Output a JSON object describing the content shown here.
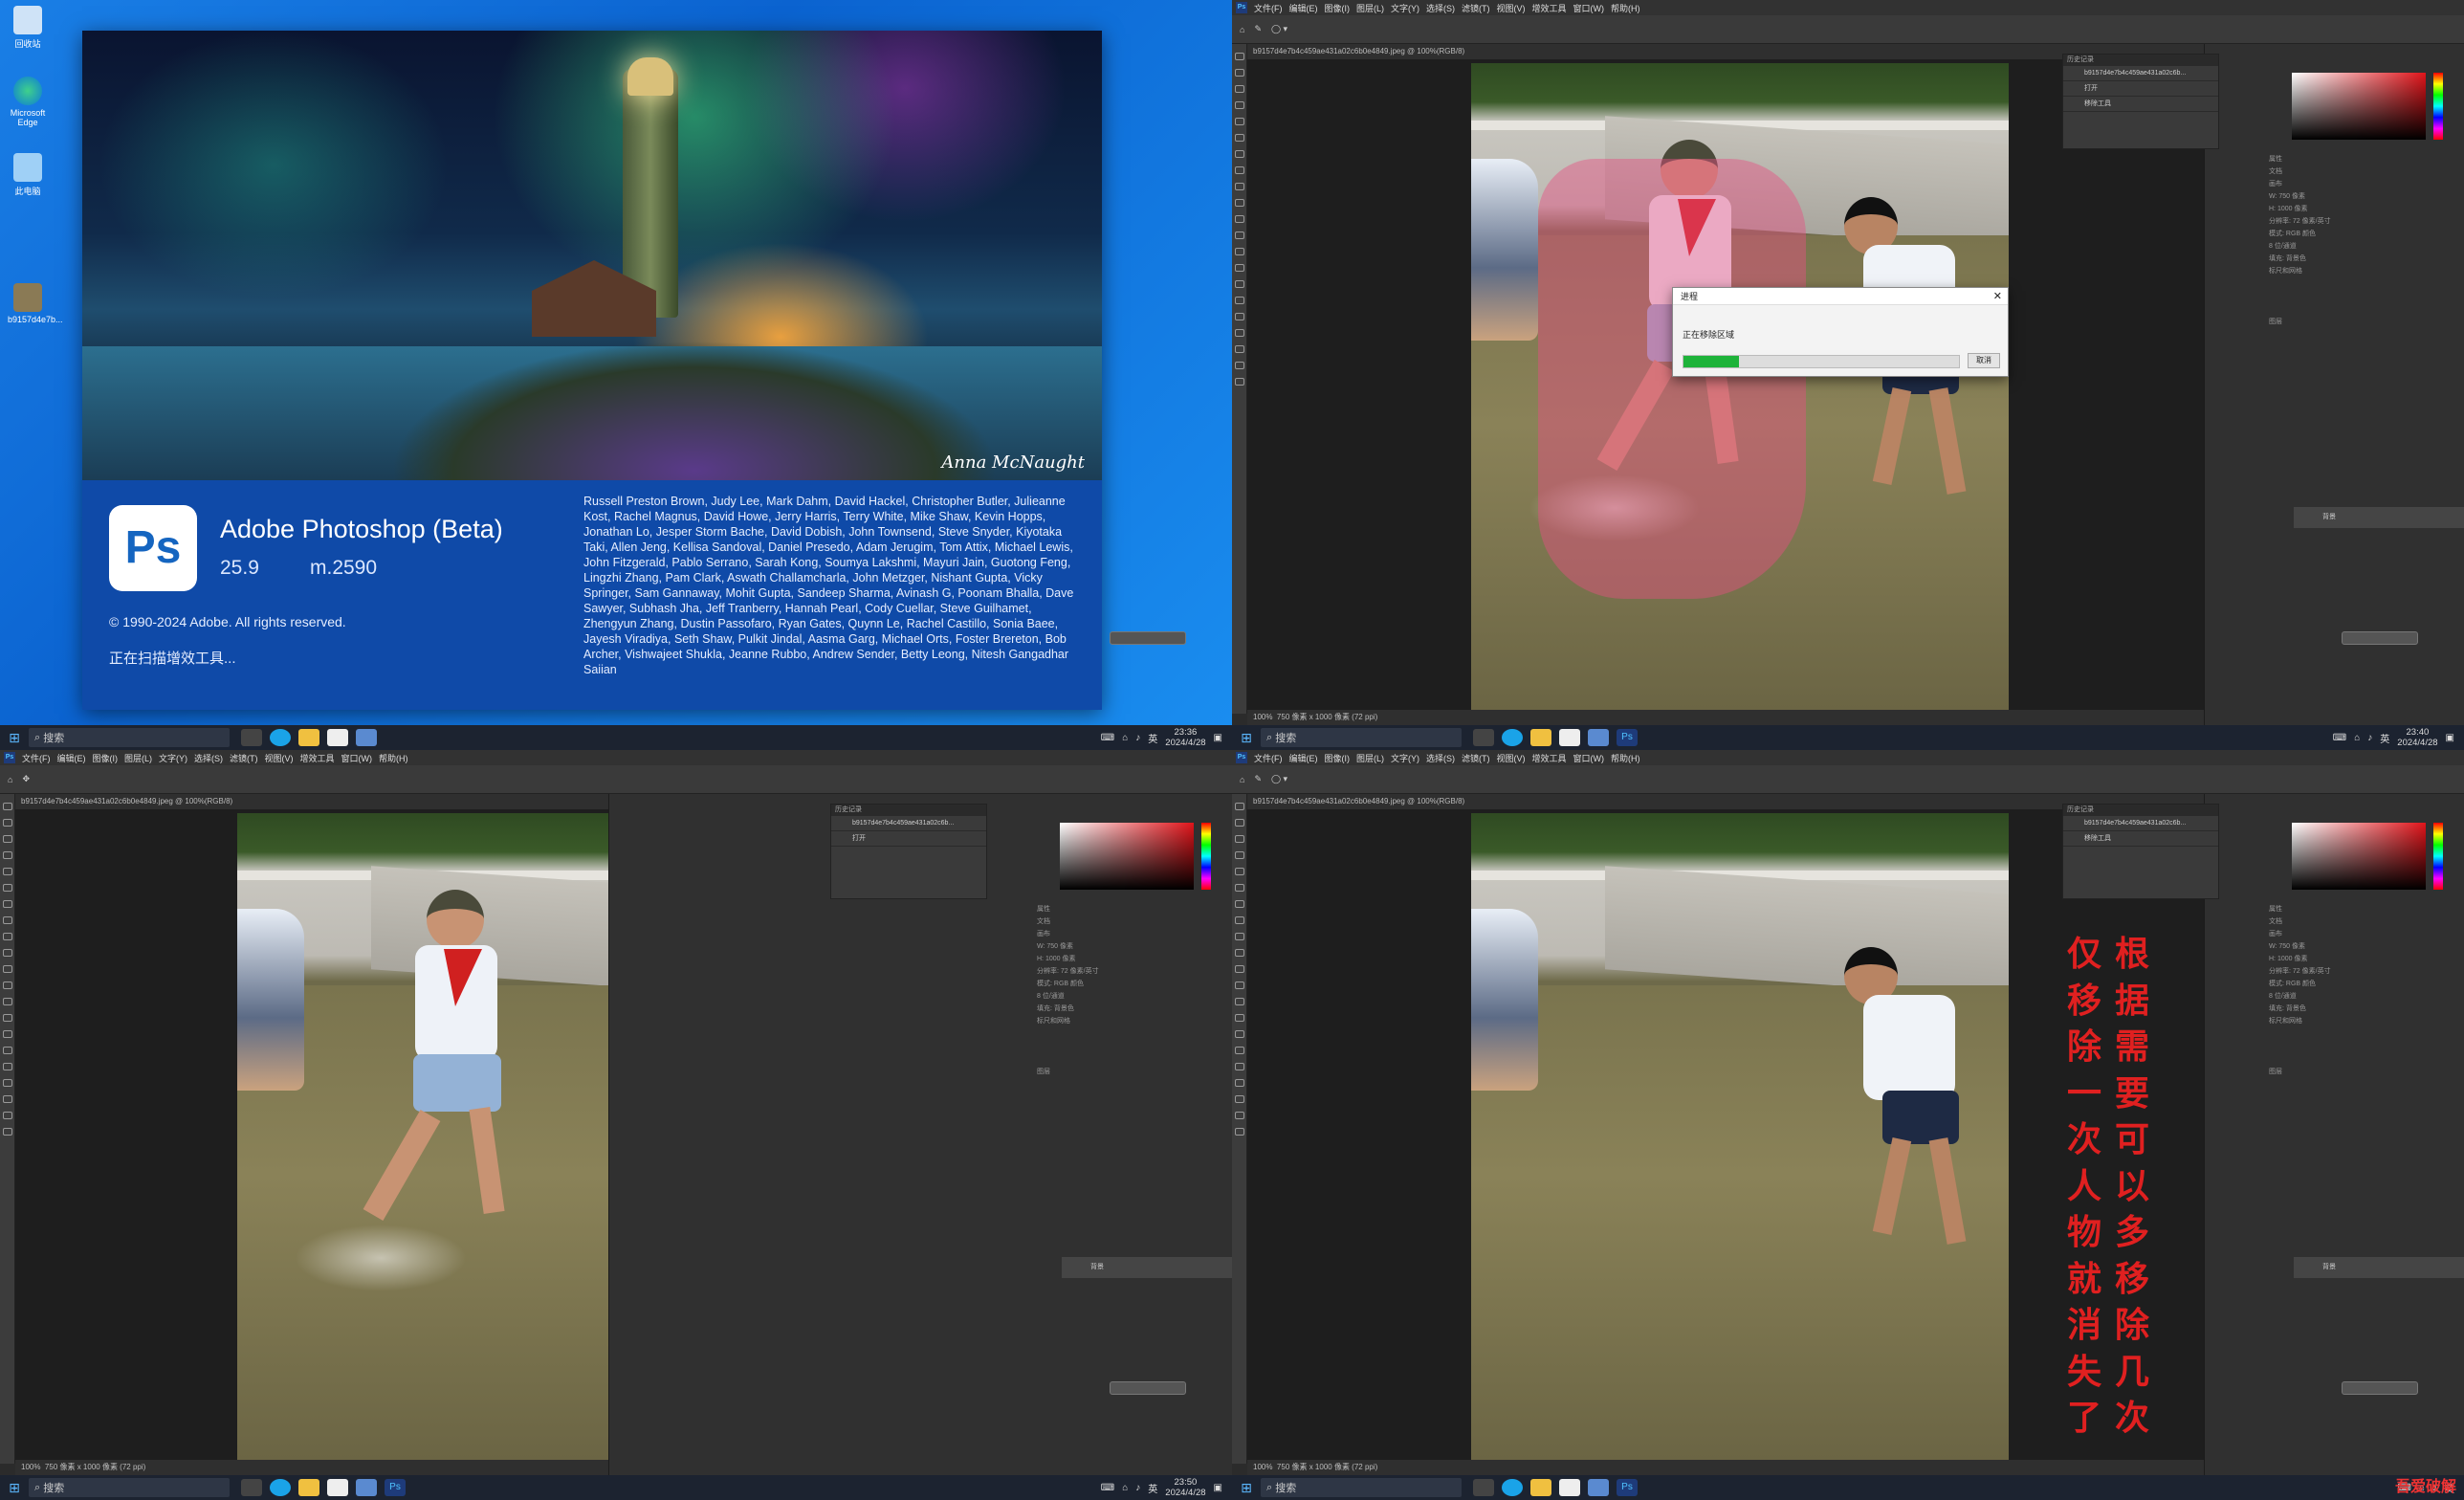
{
  "desktop": {
    "icons": [
      {
        "label": "回收站"
      },
      {
        "label": "Microsoft Edge"
      },
      {
        "label": "此电脑"
      },
      {
        "label": "b9157d4e7b..."
      }
    ]
  },
  "splash": {
    "signature": "Anna McNaught",
    "logo_text": "Ps",
    "title": "Adobe Photoshop (Beta)",
    "version": "25.9",
    "build": "m.2590",
    "copyright": "© 1990-2024 Adobe. All rights reserved.",
    "status": "正在扫描增效工具...",
    "credits": "Russell Preston Brown, Judy Lee, Mark Dahm, David Hackel, Christopher Butler, Julieanne Kost, Rachel Magnus, David Howe, Jerry Harris, Terry White, Mike Shaw, Kevin Hopps, Jonathan Lo, Jesper Storm Bache, David Dobish, John Townsend, Steve Snyder, Kiyotaka Taki, Allen Jeng, Kellisa Sandoval, Daniel Presedo, Adam Jerugim, Tom Attix, Michael Lewis, John Fitzgerald, Pablo Serrano, Sarah Kong, Soumya Lakshmi, Mayuri Jain, Guotong Feng, Lingzhi Zhang, Pam Clark, Aswath Challamcharla, John Metzger, Nishant Gupta, Vicky Springer, Sam Gannaway, Mohit Gupta, Sandeep Sharma, Avinash G, Poonam Bhalla, Dave Sawyer, Subhash Jha, Jeff Tranberry, Hannah Pearl, Cody Cuellar, Steve Guilhamet, Zhengyun Zhang, Dustin Passofaro, Ryan Gates, Quynn Le, Rachel Castillo, Sonia Baee, Jayesh Viradiya, Seth Shaw, Pulkit Jindal, Aasma Garg, Michael Orts, Foster Brereton, Bob Archer, Vishwajeet Shukla, Jeanne Rubbo, Andrew Sender, Betty Leong, Nitesh Gangadhar Saiian"
  },
  "taskbars": [
    {
      "search": "搜索",
      "time": "23:36",
      "date": "2024/4/28",
      "lang": "英"
    },
    {
      "search": "搜索",
      "time": "23:40",
      "date": "2024/4/28",
      "lang": "英"
    },
    {
      "search": "搜索",
      "time": "23:50",
      "date": "2024/4/28",
      "lang": "英"
    },
    {
      "search": "搜索",
      "time": "",
      "date": "",
      "lang": "英"
    }
  ],
  "ps": {
    "menu": [
      "文件(F)",
      "编辑(E)",
      "图像(I)",
      "图层(L)",
      "文字(Y)",
      "选择(S)",
      "滤镜(T)",
      "视图(V)",
      "增效工具",
      "窗口(W)",
      "帮助(H)"
    ],
    "doc_tab": "b9157d4e7b4c459ae431a02c6b0e4849.jpeg @ 100%(RGB/8)",
    "zoom": "100%",
    "status_text": "750 像素 x 1000 像素 (72 ppi)",
    "history_title": "历史记录",
    "history_items_tr": [
      "b9157d4e7b4c459ae431a02c6b...",
      "打开",
      "移除工具"
    ],
    "history_items_bl": [
      "b9157d4e7b4c459ae431a02c6b...",
      "打开"
    ],
    "history_items_br": [
      "b9157d4e7b4c459ae431a02c6b...",
      "移除工具"
    ],
    "props_labels": [
      "属性",
      "调整",
      "文档",
      "画布",
      "W: 750 像素",
      "H: 1000 像素",
      "分辨率: 72 像素/英寸",
      "模式: RGB 颜色",
      "8 位/通道",
      "填充: 背景色",
      "标尺和网格"
    ],
    "layers_title": "图层",
    "layer_name": "背景"
  },
  "dialog": {
    "title": "进程",
    "message": "正在移除区域",
    "cancel": "取消",
    "progress": 0.2
  },
  "annotation": {
    "col_right": "根据需要可以多移除几次",
    "col_left": "仅移除一次人物就消失了"
  },
  "watermark": "吾爱破解"
}
